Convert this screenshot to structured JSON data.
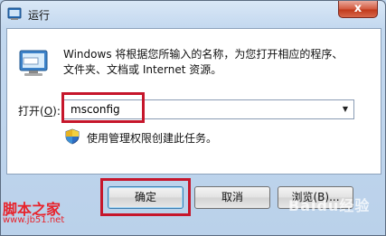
{
  "window": {
    "title": "运行",
    "close_glyph": "x",
    "title_icon": "run-icon"
  },
  "dialog": {
    "description_line1": "Windows 将根据您所输入的名称，为您打开相应的程序、",
    "description_line2": "文件夹、文档或 Internet 资源。",
    "open_label_prefix": "打开(",
    "open_label_key": "O",
    "open_label_suffix": "):",
    "input_value": "msconfig",
    "admin_note": "使用管理权限创建此任务。",
    "shield_icon": "uac-shield-icon"
  },
  "buttons": {
    "ok": "确定",
    "cancel": "取消",
    "browse": "浏览(B)..."
  },
  "watermarks": {
    "site_name": "脚本之家",
    "site_url": "www.jb51.net",
    "baidu": "Baidu经验"
  },
  "colors": {
    "highlight": "#c6162b",
    "close_button": "#c0391b",
    "watermark": "#e8232b"
  }
}
